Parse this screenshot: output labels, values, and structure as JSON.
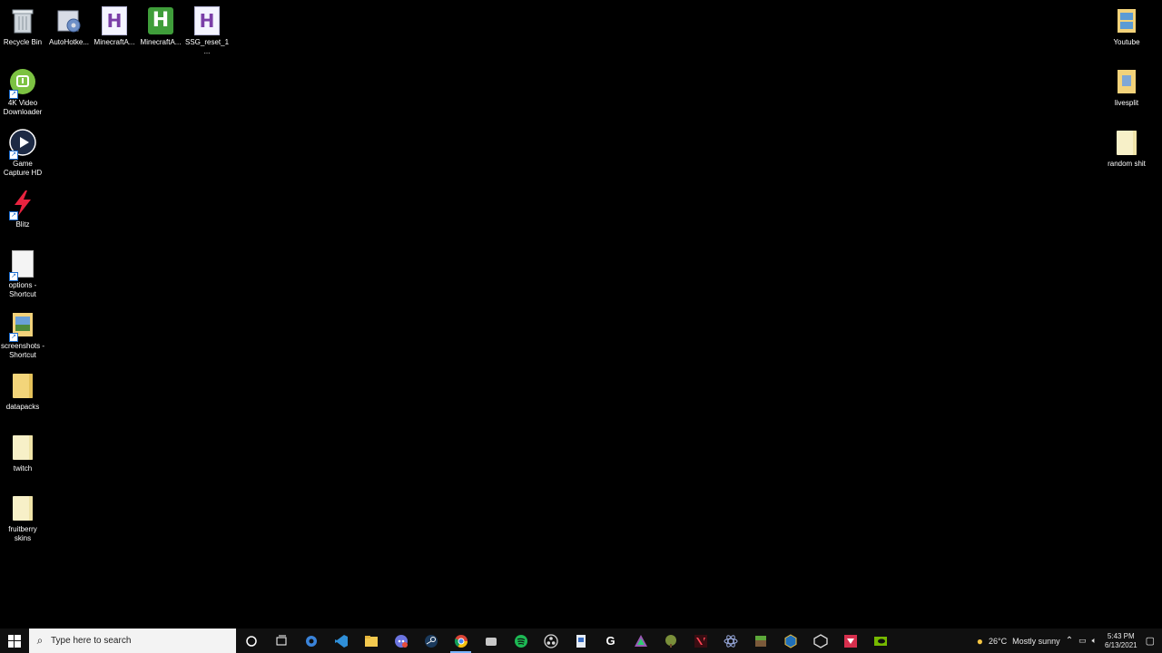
{
  "desktop": {
    "icons_left": [
      {
        "label": "Recycle Bin"
      },
      {
        "label": "AutoHotke..."
      },
      {
        "label": "MinecraftA..."
      },
      {
        "label": "MinecraftA..."
      },
      {
        "label": "SSG_reset_1..."
      }
    ],
    "icons_column": [
      {
        "label": "4K Video Downloader"
      },
      {
        "label": "Game Capture HD"
      },
      {
        "label": "Blitz"
      },
      {
        "label": "options - Shortcut"
      },
      {
        "label": "screenshots - Shortcut"
      },
      {
        "label": "datapacks"
      },
      {
        "label": "twitch"
      },
      {
        "label": "fruitberry skins"
      }
    ],
    "icons_right": [
      {
        "label": "Youtube"
      },
      {
        "label": "livesplit"
      },
      {
        "label": "random shit"
      }
    ]
  },
  "taskbar": {
    "search_placeholder": "Type here to search",
    "weather": {
      "temp": "26°C",
      "text": "Mostly sunny"
    },
    "time": "5:43 PM",
    "date": "6/13/2021"
  }
}
